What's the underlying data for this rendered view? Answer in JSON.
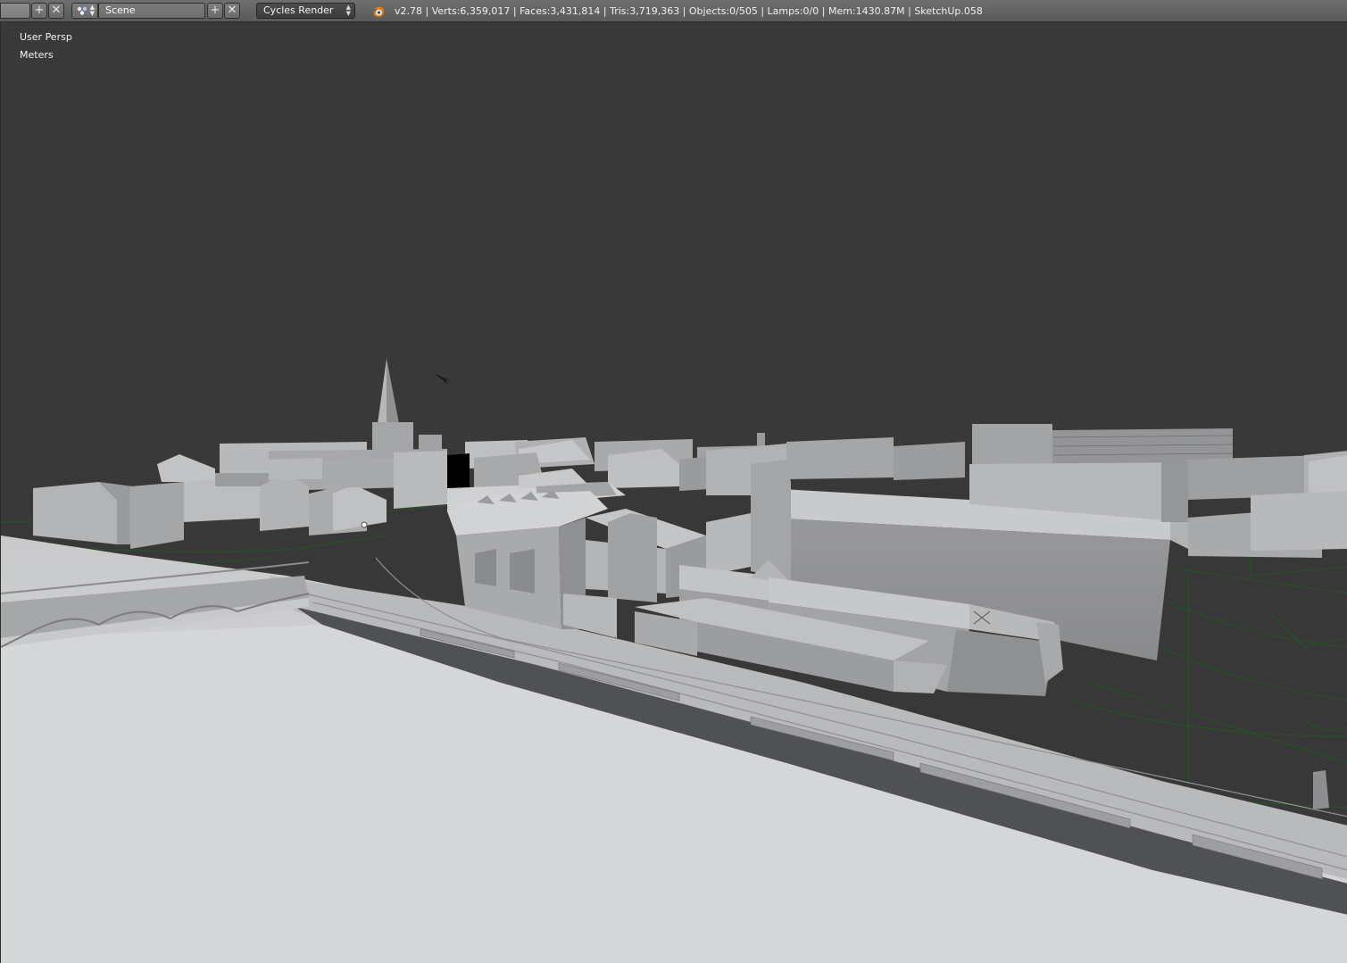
{
  "header": {
    "screen_field": "",
    "add_screen_icon": "add-icon",
    "remove_screen_icon": "close-icon",
    "scene_name": "Scene",
    "add_scene_icon": "add-icon",
    "remove_scene_icon": "close-icon",
    "render_engine": "Cycles Render",
    "stats": "v2.78 | Verts:6,359,017 | Faces:3,431,814 | Tris:3,719,363 | Objects:0/505 | Lamps:0/0 | Mem:1430.87M | SketchUp.058"
  },
  "viewport": {
    "view_name": "User Persp",
    "units": "Meters",
    "content": "3D city model in solid shading (SketchUp import)"
  },
  "colors": {
    "header_bg": "#646464",
    "viewport_bg": "#393939",
    "ground": "#d2d3d5",
    "building_light": "#c4c5c7",
    "building_shade": "#8e8f91",
    "wire_green": "#1f5a1f",
    "logo_orange": "#e87d0d"
  }
}
